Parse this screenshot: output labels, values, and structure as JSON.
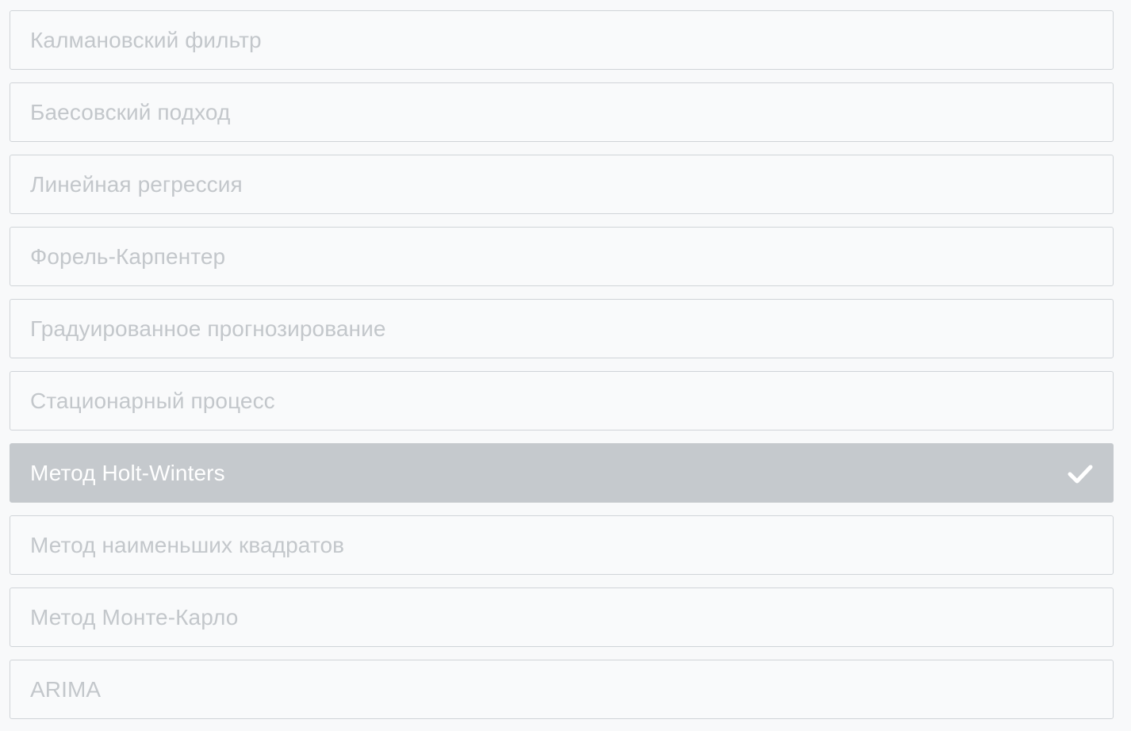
{
  "options": [
    {
      "label": "Калмановский фильтр",
      "selected": false
    },
    {
      "label": "Баесовский подход",
      "selected": false
    },
    {
      "label": "Линейная регрессия",
      "selected": false
    },
    {
      "label": "Форель-Карпентер",
      "selected": false
    },
    {
      "label": "Градуированное прогнозирование",
      "selected": false
    },
    {
      "label": "Стационарный процесс",
      "selected": false
    },
    {
      "label": "Метод Holt-Winters",
      "selected": true
    },
    {
      "label": "Метод наименьших квадратов",
      "selected": false
    },
    {
      "label": "Метод Монте-Карло",
      "selected": false
    },
    {
      "label": "ARIMA",
      "selected": false
    }
  ],
  "icons": {
    "selected_marker": "check-icon"
  },
  "colors": {
    "selected_background": "#c5c9cd",
    "option_text": "#c3c7cb",
    "selected_text": "#ffffff"
  }
}
